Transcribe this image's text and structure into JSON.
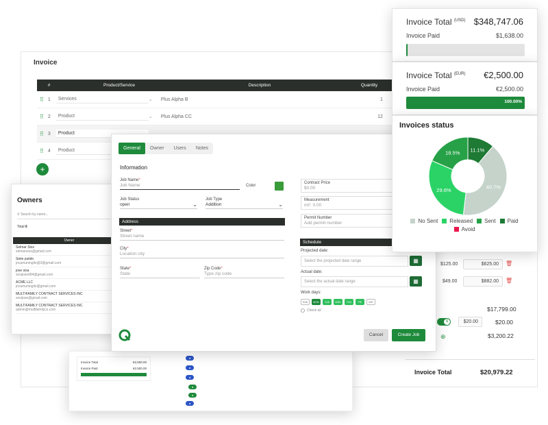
{
  "invoice": {
    "title": "Invoice",
    "columns": [
      "#",
      "Product/Service",
      "Description",
      "Quantity"
    ],
    "rows": [
      {
        "num": "1",
        "type": "Services",
        "desc": "Plus Alpha B",
        "qty": "1"
      },
      {
        "num": "2",
        "type": "Product",
        "desc": "Plus Alpha CC",
        "qty": "12"
      },
      {
        "num": "3",
        "type": "Product",
        "desc": "",
        "qty": ""
      },
      {
        "num": "4",
        "type": "Product",
        "desc": "",
        "qty": ""
      }
    ],
    "add_row": "+",
    "price_rows": [
      {
        "price": "$125.00",
        "total": "$625.00"
      },
      {
        "price": "$49.00",
        "total": "$882.00"
      }
    ],
    "subtotal": "$17,799.00",
    "fee_value": "$20.00",
    "fee_total": "$20.00",
    "tax_total": "$3,200.22",
    "total_label": "Invoice Total",
    "total_value": "$20,979.22"
  },
  "owners": {
    "title": "Owners",
    "search_placeholder": "Search by name...",
    "total_label": "Total",
    "total_value": "6",
    "column_header": "Owner",
    "items": [
      {
        "name": "Selmar Sios",
        "email": "selmarsios@gmail.com"
      },
      {
        "name": "Siete pulido",
        "email": "jncamuningilo@3@gmail.com"
      },
      {
        "name": "jose sisa",
        "email": "sosijose684@gmail.com"
      },
      {
        "name": "ACME LLC",
        "email": "jncamuningilo@gmail.com"
      },
      {
        "name": "MULTIFAMILY CONTRACT SERVICES INC",
        "email": "sosijose@gmail.com"
      },
      {
        "name": "MULTIFAMILY CONTRACT SERVICES INC",
        "email": "admin@multifamilycs.com"
      }
    ]
  },
  "job": {
    "tabs": [
      "General",
      "Owner",
      "Users",
      "Notes"
    ],
    "info_heading": "Information",
    "job_name_label": "Job Name",
    "job_name_placeholder": "Job Name",
    "color_label": "Color",
    "color_value": "#3a9b3a",
    "job_status_label": "Job Status",
    "job_status_value": "open",
    "job_type_label": "Job Type",
    "job_type_value": "Addition",
    "address_heading": "Address",
    "street_label": "Street",
    "street_placeholder": "Street name",
    "city_label": "City",
    "city_placeholder": "Location city",
    "state_label": "State",
    "state_placeholder": "State",
    "zip_label": "Zip Code",
    "zip_placeholder": "Type zip code",
    "contract_price_label": "Contract Price",
    "contract_price_placeholder": "$0.00",
    "measurement_label": "Measurement",
    "measurement_placeholder": "ml²: 0.00",
    "permit_label": "Permit Number",
    "permit_placeholder": "Add permit number",
    "schedule_heading": "Schedule",
    "projected_label": "Projected date:",
    "projected_placeholder": "Select the projected date range",
    "actual_label": "Actual date:",
    "actual_placeholder": "Select the actual date range",
    "work_days_label": "Work days:",
    "days": [
      "SUN",
      "MON",
      "TUE",
      "WED",
      "THU",
      "FRI",
      "SAT"
    ],
    "check_all": "Check all",
    "cancel": "Cancel",
    "create": "Create Job"
  },
  "usd_panel": {
    "total_label": "Invoice Total",
    "currency": "(USD)",
    "total_value": "$348,747.06",
    "paid_label": "Invoice Paid",
    "paid_value": "$1,638.00",
    "paid_fraction": 0.005
  },
  "eur_panel": {
    "total_label": "Invoice Total",
    "currency": "(EUR)",
    "total_value": "€2,500.00",
    "paid_label": "Invoice Paid",
    "paid_value": "€2,500.00",
    "paid_percent": "100.00%",
    "paid_fraction": 1.0
  },
  "chart_data": {
    "type": "pie",
    "title": "Invoices status",
    "categories": [
      "No Sent",
      "Released",
      "Sent",
      "Paid",
      "Avoid"
    ],
    "values": [
      40.7,
      29.6,
      18.5,
      11.1,
      0
    ],
    "labels": [
      "40.7%",
      "29.6%",
      "18.5%",
      "11.1%",
      ""
    ],
    "colors": [
      "#c5d3cb",
      "#2bd366",
      "#27a147",
      "#1e7a34",
      "#e8174c"
    ],
    "legend": "bottom",
    "donut": true
  },
  "mini": {
    "total_label": "Invoice Total",
    "total_value": "€2,500.00",
    "paid_label": "Invoice Paid",
    "paid_value": "€2,500.00"
  }
}
